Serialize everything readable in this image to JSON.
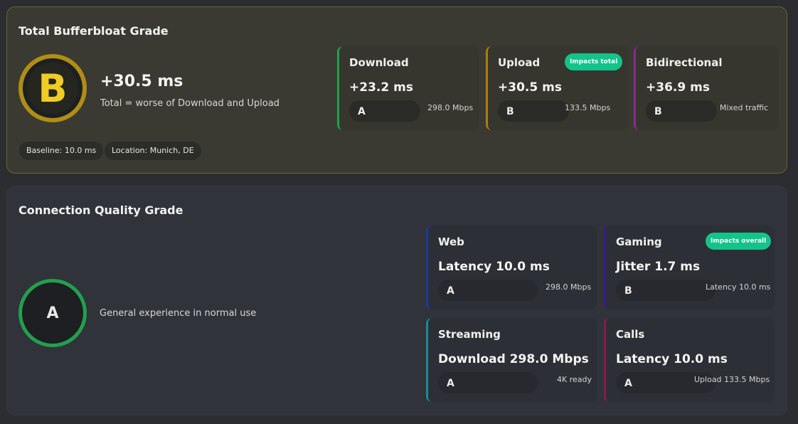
{
  "bufferbloat": {
    "title": "Total Bufferbloat Grade",
    "grade": "B",
    "total_value": "+30.5 ms",
    "total_desc": "Total = worse of Download and Upload",
    "baseline": "Baseline: 10.0 ms",
    "location": "Location: Munich, DE",
    "metrics": [
      {
        "title": "Download",
        "value": "+23.2 ms",
        "grade": "A",
        "note": "298.0 Mbps",
        "color": "#1fa24a"
      },
      {
        "title": "Upload",
        "value": "+30.5 ms",
        "grade": "B",
        "note": "133.5 Mbps",
        "badge": "Impacts total",
        "color": "#b07a14"
      },
      {
        "title": "Bidirectional",
        "value": "+36.9 ms",
        "grade": "B",
        "note": "Mixed traffic",
        "color": "#8a2a8a"
      }
    ]
  },
  "quality": {
    "title": "Connection Quality Grade",
    "grade": "A",
    "desc": "General experience in normal use",
    "metrics": [
      {
        "title": "Web",
        "value": "Latency 10.0 ms",
        "grade": "A",
        "note": "298.0 Mbps",
        "color": "#1f3a9a"
      },
      {
        "title": "Gaming",
        "value": "Jitter 1.7 ms",
        "grade": "B",
        "note": "Latency 10.0 ms",
        "badge": "Impacts overall",
        "color": "#3a1a8a"
      },
      {
        "title": "Streaming",
        "value": "Download 298.0 Mbps",
        "grade": "A",
        "note": "4K ready",
        "color": "#1a8a9a"
      },
      {
        "title": "Calls",
        "value": "Latency 10.0 ms",
        "grade": "A",
        "note": "Upload 133.5 Mbps",
        "color": "#8a1a4a"
      }
    ]
  },
  "colors": {
    "accent_badge": "#12c489",
    "grade_b": "#f0cc24",
    "ring_b": "#b08e14",
    "ring_a": "#22a04c"
  }
}
